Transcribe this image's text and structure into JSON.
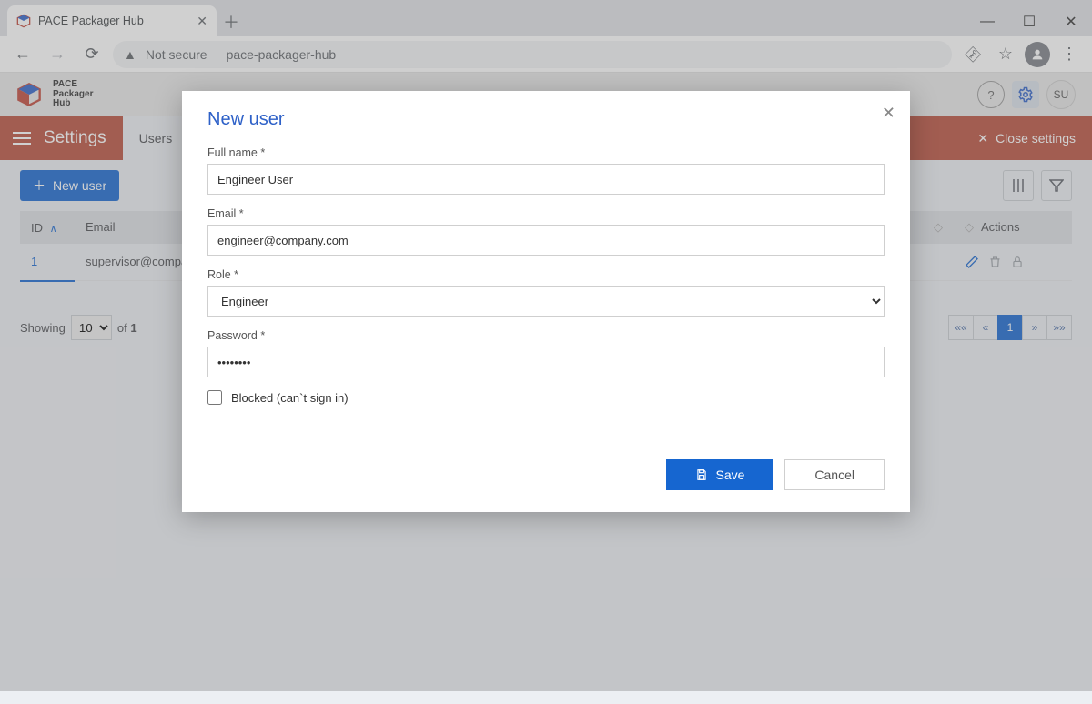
{
  "window": {
    "tab_title": "PACE Packager Hub"
  },
  "browser": {
    "not_secure": "Not secure",
    "url": "pace-packager-hub"
  },
  "app": {
    "name_line1": "PACE",
    "name_line2": "Packager",
    "name_line3": "Hub",
    "user_initials": "SU"
  },
  "settings_bar": {
    "title": "Settings",
    "active_tab": "Users",
    "close_label": "Close settings"
  },
  "toolbar": {
    "new_user_label": "New user"
  },
  "table": {
    "columns": {
      "id": "ID",
      "email": "Email",
      "actions": "Actions"
    },
    "rows": [
      {
        "id": "1",
        "email": "supervisor@company.com"
      }
    ]
  },
  "pager": {
    "showing": "Showing",
    "page_size": "10",
    "of": "of",
    "total": "1",
    "current_page": "1"
  },
  "dialog": {
    "title": "New user",
    "labels": {
      "full_name": "Full name *",
      "email": "Email *",
      "role": "Role *",
      "password": "Password *",
      "blocked": "Blocked (can`t sign in)"
    },
    "values": {
      "full_name": "Engineer User",
      "email": "engineer@company.com",
      "role": "Engineer",
      "password": "••••••••"
    },
    "actions": {
      "save": "Save",
      "cancel": "Cancel"
    }
  },
  "pagination_symbols": {
    "first": "««",
    "prev": "«",
    "next": "»",
    "last": "»»"
  }
}
